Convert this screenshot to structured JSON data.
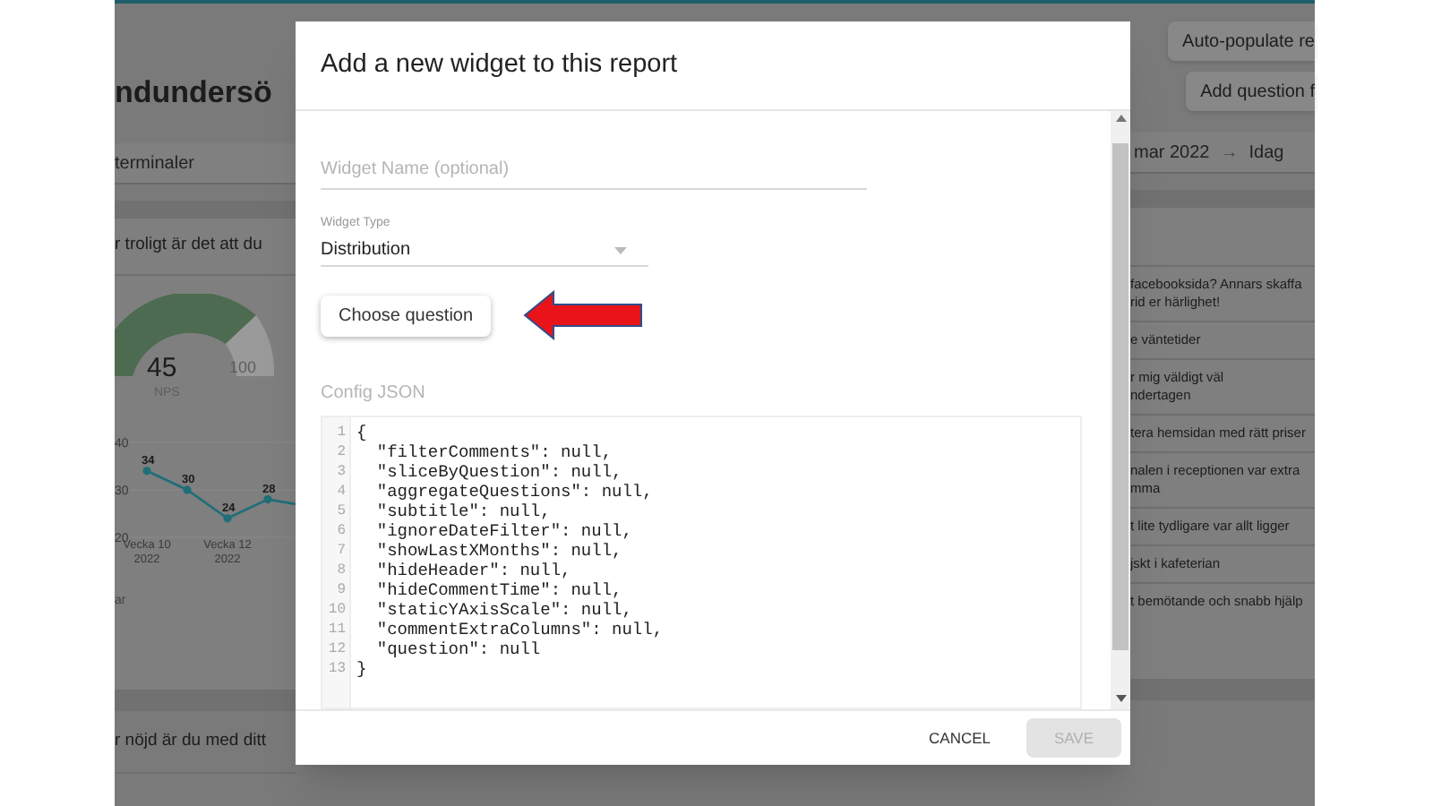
{
  "background": {
    "title": "ndundersö",
    "buttons": [
      "Auto-populate re",
      "Add question f"
    ],
    "filter_left": "terminaler",
    "date_from": "mar 2022",
    "date_arrow": "→",
    "date_to": "Idag",
    "question_1": "r troligt är det att du",
    "gauge": {
      "value": "45",
      "label": "NPS",
      "max": "100"
    },
    "chart_data": {
      "type": "line",
      "categories": [
        "Vecka 10 2022",
        null,
        "Vecka 12 2022",
        null
      ],
      "series": [
        {
          "color": "#1f6e78",
          "marker": "circle",
          "values": [
            34,
            30,
            24,
            28
          ]
        }
      ],
      "ylim": [
        20,
        40
      ],
      "yticks": [
        20,
        30,
        40
      ],
      "data_labels": true
    },
    "chart_note": "ar",
    "question_2": "r nöjd är du med ditt",
    "comments": [
      [
        "facebooksida? Annars skaffa",
        "rid er härlighet!"
      ],
      [
        "e väntetider"
      ],
      [
        "r mig väldigt väl",
        "ndertagen"
      ],
      [
        "tera hemsidan med rätt priser"
      ],
      [
        "nalen i receptionen var extra",
        "mma"
      ],
      [
        "t lite tydligare var allt ligger"
      ],
      [
        "jskt i kafeterian"
      ],
      [
        "t bemötande och snabb hjälp"
      ]
    ]
  },
  "dialog": {
    "title": "Add a new widget to this report",
    "widget_name": {
      "placeholder": "Widget Name (optional)"
    },
    "widget_type": {
      "label": "Widget Type",
      "value": "Distribution"
    },
    "choose_button": "Choose question",
    "config_label": "Config JSON",
    "code_lines": [
      {
        "number": "1",
        "code": "{"
      },
      {
        "number": "2",
        "code": "  \"filterComments\": null,"
      },
      {
        "number": "3",
        "code": "  \"sliceByQuestion\": null,"
      },
      {
        "number": "4",
        "code": "  \"aggregateQuestions\": null,"
      },
      {
        "number": "5",
        "code": "  \"subtitle\": null,"
      },
      {
        "number": "6",
        "code": "  \"ignoreDateFilter\": null,"
      },
      {
        "number": "7",
        "code": "  \"showLastXMonths\": null,"
      },
      {
        "number": "8",
        "code": "  \"hideHeader\": null,"
      },
      {
        "number": "9",
        "code": "  \"hideCommentTime\": null,"
      },
      {
        "number": "10",
        "code": "  \"staticYAxisScale\": null,"
      },
      {
        "number": "11",
        "code": "  \"commentExtraColumns\": null,"
      },
      {
        "number": "12",
        "code": "  \"question\": null"
      },
      {
        "number": "13",
        "code": "}"
      }
    ],
    "cancel": {
      "label": "CANCEL"
    },
    "save": {
      "label": "SAVE",
      "disabled": true
    }
  }
}
